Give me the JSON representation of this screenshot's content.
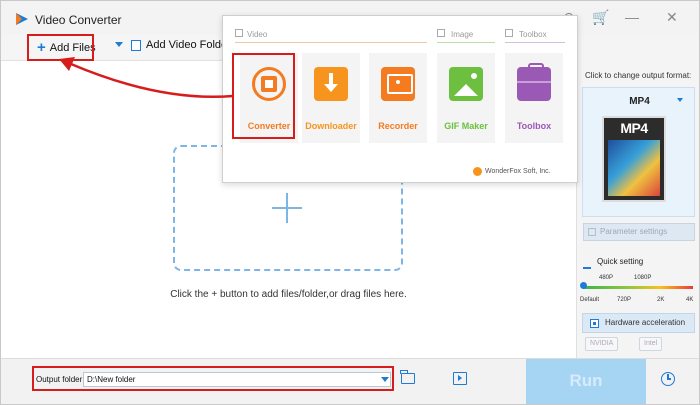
{
  "app": {
    "title": "Video Converter"
  },
  "toolbar": {
    "add_files_label": "Add Files",
    "add_video_folder_label": "Add Video Folder"
  },
  "main": {
    "hint": "Click the + button to add files/folder,or drag files here."
  },
  "popup": {
    "sections": {
      "video": "Video",
      "image": "Image",
      "toolbox": "Toolbox"
    },
    "tools": [
      {
        "label": "Converter",
        "color": "#f47b20"
      },
      {
        "label": "Downloader",
        "color": "#f7941d"
      },
      {
        "label": "Recorder",
        "color": "#f47b20"
      },
      {
        "label": "GIF Maker",
        "color": "#6cbf3f"
      },
      {
        "label": "Toolbox",
        "color": "#9b59b6"
      }
    ],
    "footer": "WonderFox Soft, Inc."
  },
  "right_panel": {
    "change_format_label": "Click to change output format:",
    "format": "MP4",
    "format_icon_text": "MP4",
    "parameter_settings": "Parameter settings",
    "quick_setting": "Quick setting",
    "ticks_top": [
      "480P",
      "1080P"
    ],
    "ticks_bottom": [
      "Default",
      "720P",
      "2K",
      "4K"
    ],
    "hardware_acceleration": "Hardware acceleration",
    "gpu_options": [
      "NVIDIA",
      "Intel"
    ]
  },
  "bottom": {
    "output_label": "Output folder:",
    "output_value": "D:\\New folder",
    "run_label": "Run"
  },
  "colors": {
    "accent": "#1e7bd7",
    "highlight": "#d71c1c",
    "run_button": "#a6d4f3"
  }
}
